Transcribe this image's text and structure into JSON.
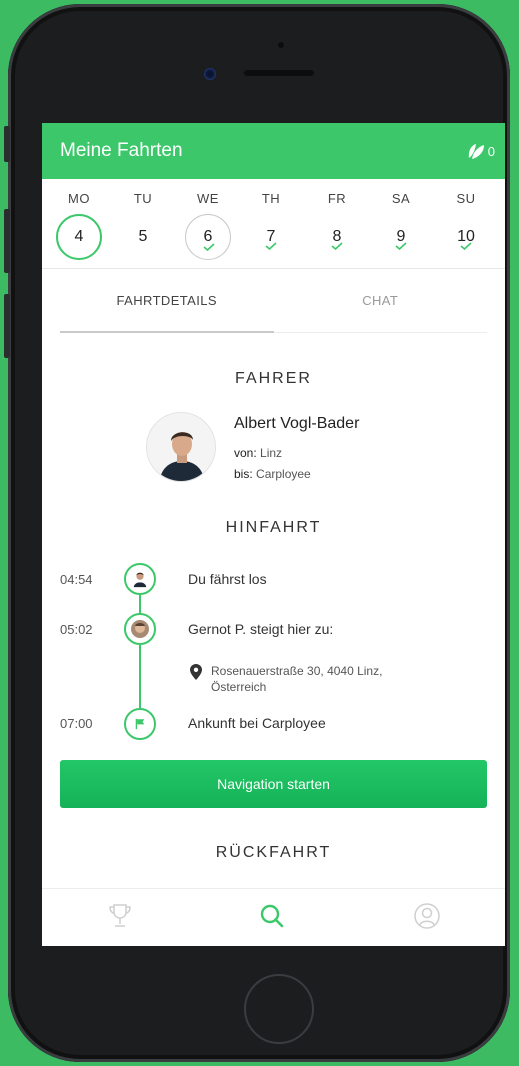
{
  "header": {
    "title": "Meine Fahrten",
    "leaf_count": "0"
  },
  "week": [
    {
      "name": "MO",
      "num": "4",
      "state": "active",
      "check": false
    },
    {
      "name": "TU",
      "num": "5",
      "state": "normal",
      "check": false
    },
    {
      "name": "WE",
      "num": "6",
      "state": "today",
      "check": true
    },
    {
      "name": "TH",
      "num": "7",
      "state": "normal",
      "check": true
    },
    {
      "name": "FR",
      "num": "8",
      "state": "normal",
      "check": true
    },
    {
      "name": "SA",
      "num": "9",
      "state": "normal",
      "check": true
    },
    {
      "name": "SU",
      "num": "10",
      "state": "normal",
      "check": true
    }
  ],
  "tabs": {
    "details": "FAHRTDETAILS",
    "chat": "CHAT"
  },
  "driver_section": {
    "heading": "FAHRER",
    "name": "Albert Vogl-Bader",
    "from_label": "von:",
    "from": "Linz",
    "to_label": "bis:",
    "to": "Carployee"
  },
  "outbound": {
    "heading": "HINFAHRT",
    "stops": [
      {
        "time": "04:54",
        "text": "Du fährst los"
      },
      {
        "time": "05:02",
        "text": "Gernot P. steigt hier zu:"
      },
      {
        "time": "07:00",
        "text": "Ankunft bei Carployee"
      }
    ],
    "address_line1": "Rosenauerstraße 30, 4040 Linz,",
    "address_line2": "Österreich"
  },
  "navigation_button": "Navigation starten",
  "return": {
    "heading": "RÜCKFAHRT"
  },
  "colors": {
    "accent": "#3cc86a",
    "background": "#3dbb62"
  }
}
